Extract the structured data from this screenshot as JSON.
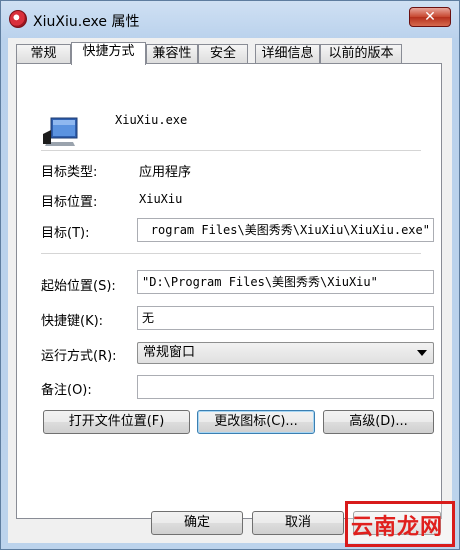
{
  "window": {
    "title": "XiuXiu.exe 属性",
    "close_glyph": "✕"
  },
  "tabs": [
    "常规",
    "快捷方式",
    "兼容性",
    "安全",
    "详细信息",
    "以前的版本"
  ],
  "active_tab": "快捷方式",
  "shortcut": {
    "file_name": "XiuXiu.exe",
    "target_type_label": "目标类型:",
    "target_type_value": "应用程序",
    "target_location_label": "目标位置:",
    "target_location_value": "XiuXiu",
    "target_label": "目标(T):",
    "target_value": "rogram Files\\美图秀秀\\XiuXiu\\XiuXiu.exe\"",
    "start_in_label": "起始位置(S):",
    "start_in_value": "\"D:\\Program Files\\美图秀秀\\XiuXiu\"",
    "hotkey_label": "快捷键(K):",
    "hotkey_value": "无",
    "run_label": "运行方式(R):",
    "run_value": "常规窗口",
    "comment_label": "备注(O):",
    "comment_value": ""
  },
  "buttons": {
    "open_location": "打开文件位置(F)",
    "change_icon": "更改图标(C)...",
    "advanced": "高级(D)...",
    "ok": "确定",
    "cancel": "取消"
  },
  "watermark": "云南龙网",
  "colors": {
    "close_button": "#c7462e",
    "highlight_box": "#d81b1b"
  }
}
